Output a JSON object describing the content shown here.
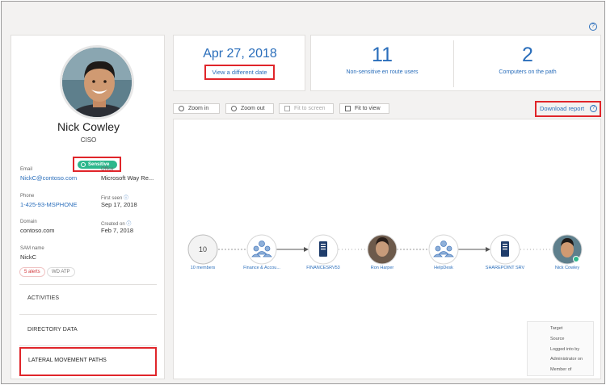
{
  "user": {
    "name": "Nick Cowley",
    "role": "CISO",
    "sensitive_label": "Sensitive",
    "fields": {
      "email_label": "Email",
      "email": "NickC@contoso.com",
      "office_label": "Office",
      "office": "Microsoft Way Re...",
      "phone_label": "Phone",
      "phone": "1-425-93-MSPHONE",
      "first_seen_label": "First seen",
      "first_seen": "Sep 17, 2018",
      "domain_label": "Domain",
      "domain": "contoso.com",
      "created_label": "Created on",
      "created": "Feb 7, 2018",
      "sam_label": "SAM name",
      "sam": "NickC"
    },
    "badges": {
      "alerts": "5 alerts",
      "wdatp": "WD ATP"
    },
    "menu": {
      "activities": "ACTIVITIES",
      "directory": "DIRECTORY DATA",
      "lmp": "LATERAL MOVEMENT PATHS"
    }
  },
  "header": {
    "date": "Apr 27, 2018",
    "view_date": "View a different date",
    "users_count": "11",
    "users_label": "Non-sensitive en route users",
    "computers_count": "2",
    "computers_label": "Computers on the path"
  },
  "toolbar": {
    "zoom_in": "Zoom in",
    "zoom_out": "Zoom out",
    "fit_screen": "Fit to screen",
    "fit_view": "Fit to view",
    "download": "Download report"
  },
  "graph": {
    "nodes": [
      {
        "label": "10 members",
        "count": "10"
      },
      {
        "label": "Finance & Accou..."
      },
      {
        "label": "FINANCESRV53"
      },
      {
        "label": "Ron Harper"
      },
      {
        "label": "HelpDesk"
      },
      {
        "label": "SHAREPOINT SRV"
      },
      {
        "label": "Nick Cowley"
      }
    ],
    "legend": {
      "target": "Target",
      "source": "Source",
      "logged": "Logged into by",
      "admin": "Administrator on",
      "member": "Member of"
    }
  },
  "colors": {
    "accent": "#2a6ebb",
    "highlight": "#e0252a",
    "sensitive": "#2db78c"
  },
  "icons": [
    "help-icon",
    "sensitive-icon",
    "zoom-in-icon",
    "zoom-out-icon",
    "fit-screen-icon",
    "fit-view-icon",
    "group-icon",
    "server-icon"
  ]
}
